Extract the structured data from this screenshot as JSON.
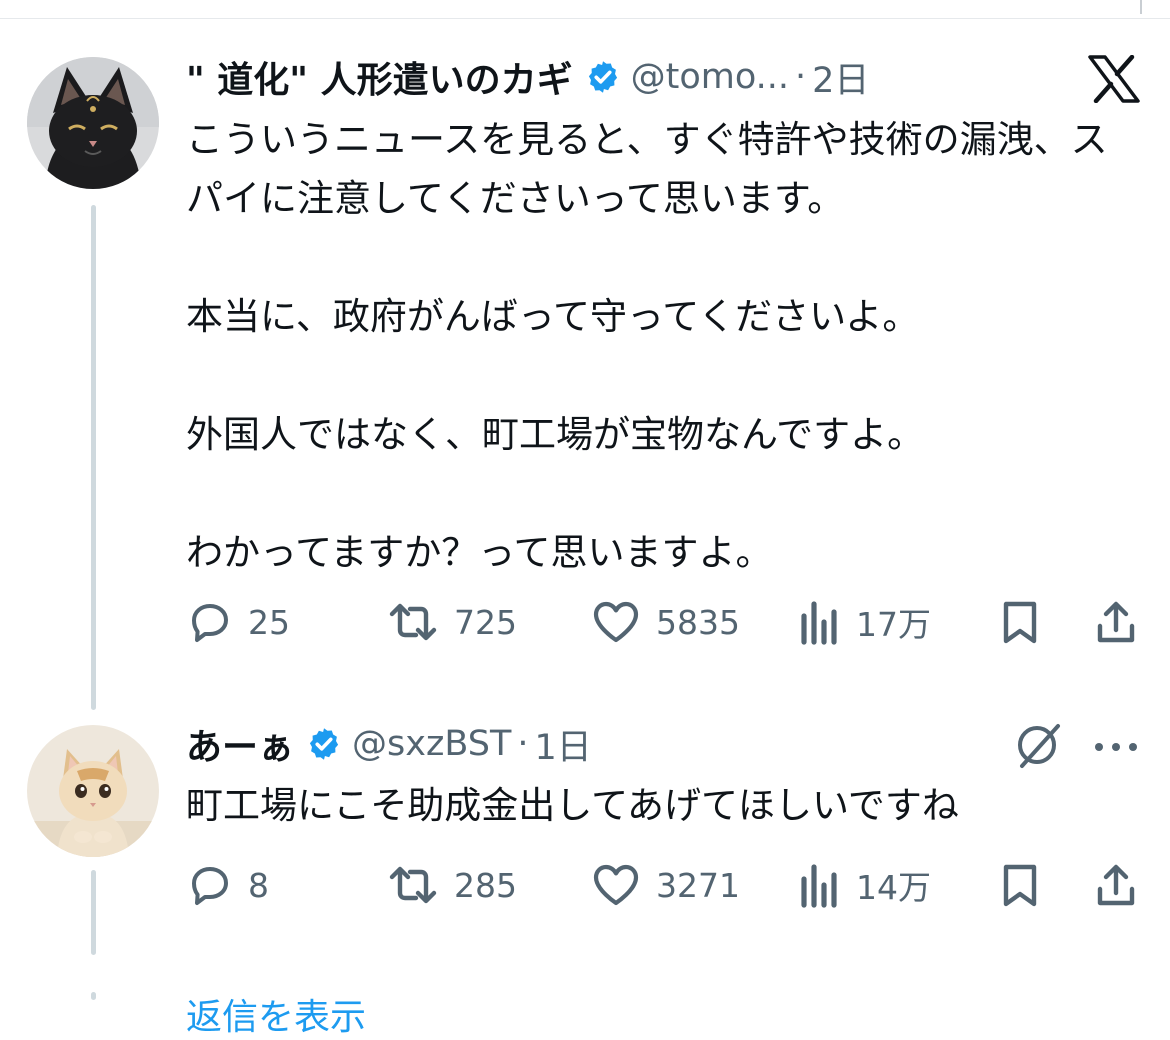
{
  "colors": {
    "text_primary": "#0f1419",
    "text_secondary": "#536471",
    "verified_blue": "#1d9bf0",
    "thread_line": "#cfd9de"
  },
  "tweets": [
    {
      "display_name": "\" 道化\" 人形遣いのカギ",
      "handle": "@tomo...",
      "separator": "·",
      "time": "2日",
      "verified_icon": "verified-badge-icon",
      "avatar_icon": "black-cat-avatar",
      "corner_icon": "x-logo-icon",
      "text": "こういうニュースを見ると、すぐ特許や技術の漏洩、スパイに注意してくださいって思います。\n\n本当に、政府がんばって守ってくださいよ。\n\n外国人ではなく、町工場が宝物なんですよ。\n\nわかってますか？って思いますよ。",
      "actions": {
        "replies": "25",
        "retweets": "725",
        "likes": "5835",
        "views": "17万"
      }
    },
    {
      "display_name": "あーぁ",
      "handle": "@sxzBST",
      "separator": "·",
      "time": "1日",
      "verified_icon": "verified-badge-icon",
      "avatar_icon": "kitten-avatar",
      "corner_icon": "grok-icon",
      "more_icon": "more-horizontal-icon",
      "text": "町工場にこそ助成金出してあげてほしいですね",
      "actions": {
        "replies": "8",
        "retweets": "285",
        "likes": "3271",
        "views": "14万"
      }
    }
  ],
  "footer": {
    "more_replies": "返信を表示"
  }
}
